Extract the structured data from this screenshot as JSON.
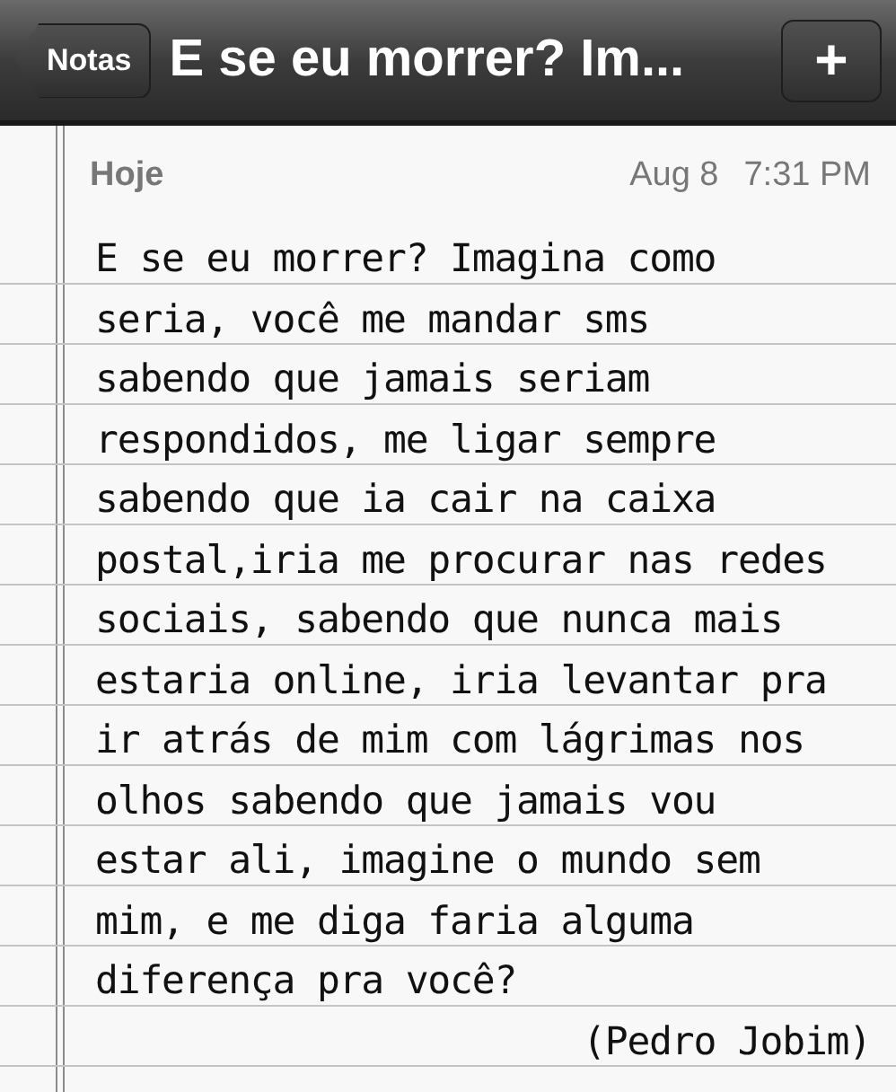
{
  "nav_bar": {
    "back_button": "Notas",
    "title": "E se eu morrer? Im...",
    "add_button": "+"
  },
  "note": {
    "day": "Hoje",
    "date": "Aug 8",
    "time": "7:31 PM",
    "body": "E se eu morrer? Imagina como\nseria, você me mandar sms\nsabendo que jamais seriam\nrespondidos, me ligar sempre\nsabendo que ia cair na caixa\npostal,iria me procurar nas redes\nsociais, sabendo que nunca mais\nestaria online, iria levantar pra\nir atrás de mim com lágrimas nos\nolhos sabendo que jamais vou\nestar ali, imagine o mundo sem\nmim, e me diga faria alguma\ndiferença pra você?",
    "signature": "(Pedro Jobim)"
  }
}
